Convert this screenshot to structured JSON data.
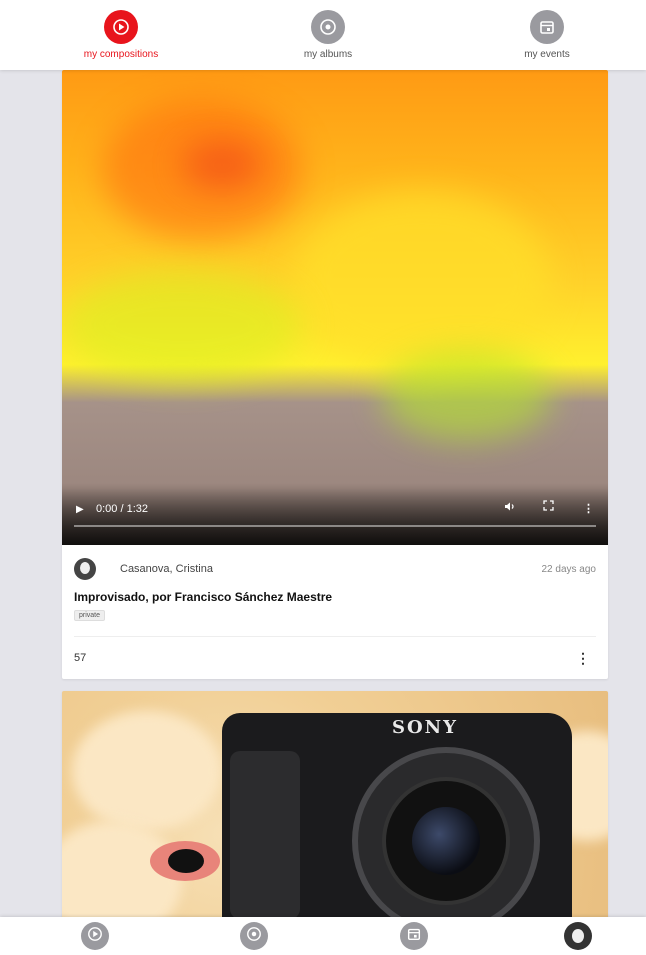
{
  "top_tabs": [
    {
      "label": "my compositions",
      "icon": "play-circle-icon",
      "active": true
    },
    {
      "label": "my albums",
      "icon": "disc-icon",
      "active": false
    },
    {
      "label": "my events",
      "icon": "calendar-icon",
      "active": false
    }
  ],
  "accent_color": "#e8141c",
  "video_card": {
    "player": {
      "time": "0:00 / 1:32"
    },
    "author": "Casanova, Cristina",
    "time_ago": "22 days ago",
    "title": "Improvisado, por Francisco Sánchez Maestre",
    "visibility_tag": "private",
    "plays": "57"
  },
  "photo_card": {
    "brand_text": "SONY"
  },
  "bottom_nav": [
    {
      "icon": "play-circle-icon"
    },
    {
      "icon": "disc-icon"
    },
    {
      "icon": "calendar-icon"
    },
    {
      "icon": "profile-avatar-icon"
    }
  ]
}
